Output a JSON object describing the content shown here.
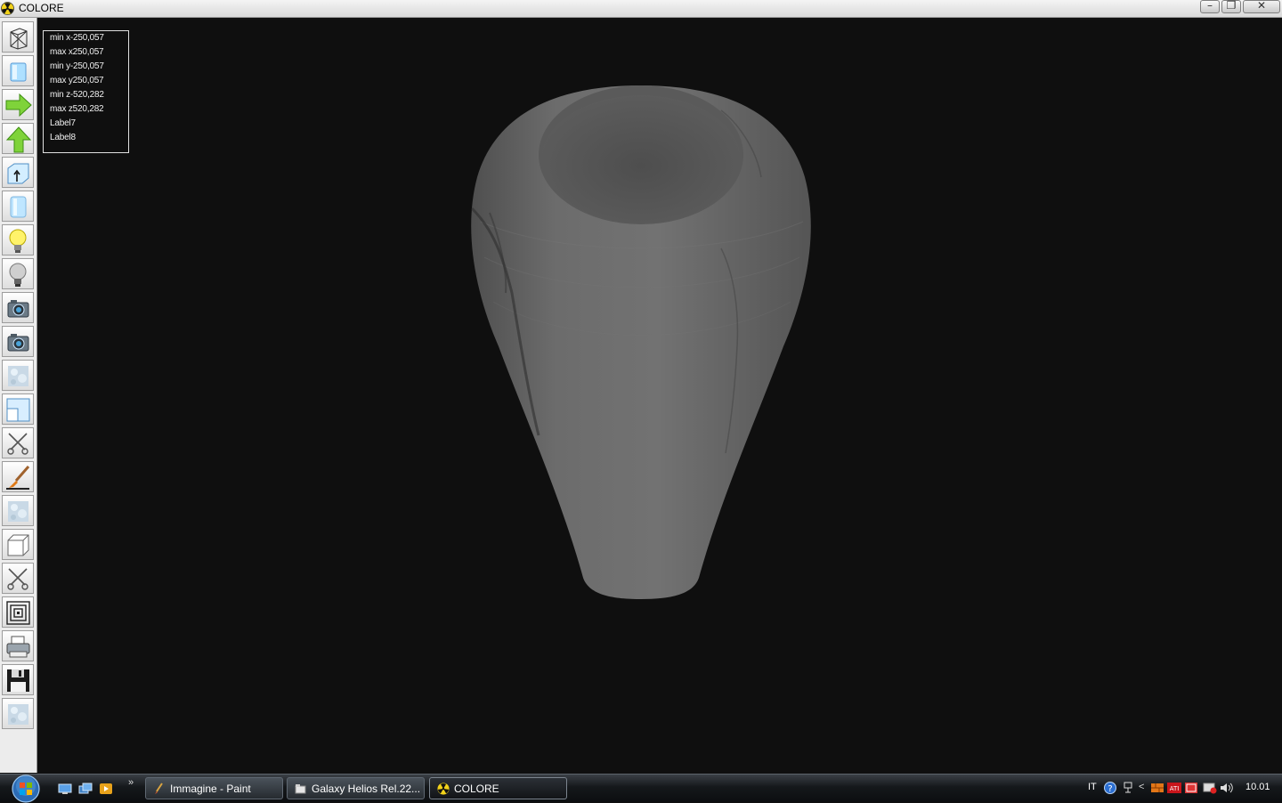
{
  "window": {
    "title": "COLORE",
    "controls": [
      "minimize",
      "restore",
      "close"
    ]
  },
  "toolbar": {
    "buttons": [
      {
        "name": "wireframe-box",
        "icon": "wireframe-box-icon"
      },
      {
        "name": "solid-box",
        "icon": "solid-box-icon"
      },
      {
        "name": "arrow-right",
        "icon": "green-arrow-right-icon"
      },
      {
        "name": "arrow-up",
        "icon": "green-arrow-up-icon"
      },
      {
        "name": "box-up",
        "icon": "box-up-arrow-icon"
      },
      {
        "name": "cylinder",
        "icon": "cylinder-icon"
      },
      {
        "name": "light-on",
        "icon": "lightbulb-on-icon"
      },
      {
        "name": "light-off",
        "icon": "lightbulb-off-icon"
      },
      {
        "name": "camera-1",
        "icon": "camera-icon"
      },
      {
        "name": "camera-2",
        "icon": "camera-icon"
      },
      {
        "name": "texture-1",
        "icon": "texture-icon"
      },
      {
        "name": "window-split",
        "icon": "window-split-icon"
      },
      {
        "name": "cut-1",
        "icon": "scissors-icon"
      },
      {
        "name": "paint",
        "icon": "paintbrush-icon"
      },
      {
        "name": "texture-2",
        "icon": "texture-icon"
      },
      {
        "name": "cube",
        "icon": "cube-icon"
      },
      {
        "name": "cut-2",
        "icon": "scissors-icon"
      },
      {
        "name": "frame",
        "icon": "concentric-squares-icon"
      },
      {
        "name": "print",
        "icon": "printer-icon"
      },
      {
        "name": "save",
        "icon": "floppy-disk-icon"
      },
      {
        "name": "texture-3",
        "icon": "texture-icon"
      }
    ]
  },
  "info": {
    "min_x": "min x-250,057",
    "max_x": "max x250,057",
    "min_y": "min y-250,057",
    "max_y": "max y250,057",
    "min_z": "min z-520,282",
    "max_z": "max z520,282",
    "label7": "Label7",
    "label8": "Label8"
  },
  "viewport": {
    "object": "vase",
    "colors": {
      "background": "#0f0f0f",
      "vase": "#6b6b6b"
    }
  },
  "taskbar": {
    "tasks": [
      {
        "label": "Immagine - Paint",
        "icon": "paint-icon",
        "active": false
      },
      {
        "label": "Galaxy Helios  Rel.22...",
        "icon": "folder-icon",
        "active": false
      },
      {
        "label": "COLORE",
        "icon": "radiation-icon",
        "active": true
      }
    ],
    "tray": {
      "language": "IT",
      "clock": "10.01"
    }
  }
}
